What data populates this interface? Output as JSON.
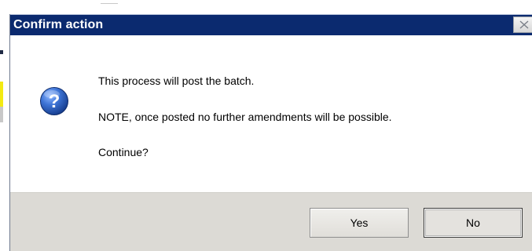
{
  "dialog": {
    "title": "Confirm action",
    "close_icon": "close-icon",
    "message_icon": "question-icon",
    "messages": [
      "This process will post the batch.",
      "NOTE, once posted no further amendments will be possible.",
      "Continue?"
    ],
    "buttons": {
      "yes_label": "Yes",
      "no_label": "No"
    }
  },
  "colors": {
    "title_bar": "#0b2a6f",
    "title_text": "#ffffff",
    "footer": "#dcdad5",
    "icon_blue": "#2d63c0"
  }
}
